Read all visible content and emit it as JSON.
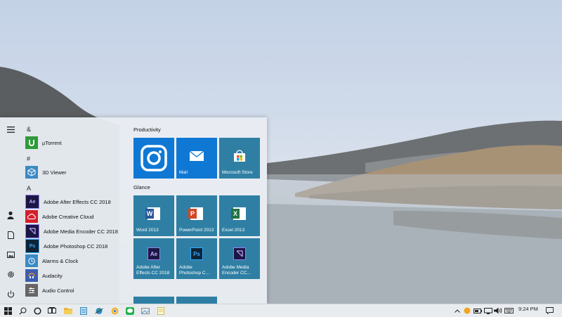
{
  "start_menu": {
    "rail_icons": [
      "hamburger-icon",
      "user-icon",
      "documents-icon",
      "pictures-icon",
      "settings-icon",
      "power-icon"
    ],
    "letters": {
      "amp": "&",
      "hash": "#",
      "a": "A"
    },
    "apps": [
      {
        "label": "µTorrent",
        "icon": "utorrent-icon",
        "color": "#2e9b3a"
      },
      {
        "label": "3D Viewer",
        "icon": "3d-viewer-icon",
        "color": "#3b8ac4"
      },
      {
        "label": "Adobe After Effects CC 2018",
        "icon": "after-effects-icon",
        "color": "#1b1744",
        "glyph": "Ae"
      },
      {
        "label": "Adobe Creative Cloud",
        "icon": "creative-cloud-icon",
        "color": "#d4202c"
      },
      {
        "label": "Adobe Media Encoder CC 2018",
        "icon": "media-encoder-icon",
        "color": "#1b1744"
      },
      {
        "label": "Adobe Photoshop CC 2018",
        "icon": "photoshop-icon",
        "color": "#0e2436",
        "glyph": "Ps"
      },
      {
        "label": "Alarms & Clock",
        "icon": "alarm-clock-icon",
        "color": "#3b8ac4"
      },
      {
        "label": "Audacity",
        "icon": "audacity-icon",
        "color": "#3b5fb0"
      },
      {
        "label": "Audio Control",
        "icon": "audio-control-icon",
        "color": "#666666"
      }
    ],
    "groups": [
      {
        "title": "Productivity"
      },
      {
        "title": "Glance"
      }
    ],
    "tiles": {
      "instagram": {
        "label": ""
      },
      "mail": {
        "label": "Mail"
      },
      "store": {
        "label": "Microsoft Store"
      },
      "word": {
        "label": "Word 2013",
        "glyph": "W"
      },
      "powerpoint": {
        "label": "PowerPoint 2013",
        "glyph": "P"
      },
      "excel": {
        "label": "Excel 2013",
        "glyph": "X"
      },
      "after_effects": {
        "label": "Adobe After Effects CC 2018",
        "glyph": "Ae"
      },
      "photoshop": {
        "label": "Adobe Photoshop C...",
        "glyph": "Ps"
      },
      "media_encoder": {
        "label": "Adobe Media Encoder CC..."
      }
    },
    "colors": {
      "tile": "#2f7fa4",
      "mail_tile": "#0f78d4",
      "instagram_tile": "#0f78d4"
    }
  },
  "taskbar": {
    "time": "9:24 PM",
    "icons": [
      "windows-start-icon",
      "search-icon",
      "cortana-icon",
      "task-view-icon",
      "file-explorer-icon",
      "notepad-icon",
      "earth-icon",
      "chrome-icon",
      "line-icon",
      "media-icon",
      "notes-icon"
    ],
    "tray_icons": [
      "chevron-up-icon",
      "onedrive-icon",
      "battery-icon",
      "network-icon",
      "volume-icon",
      "keyboard-icon",
      "notification-icon"
    ]
  }
}
